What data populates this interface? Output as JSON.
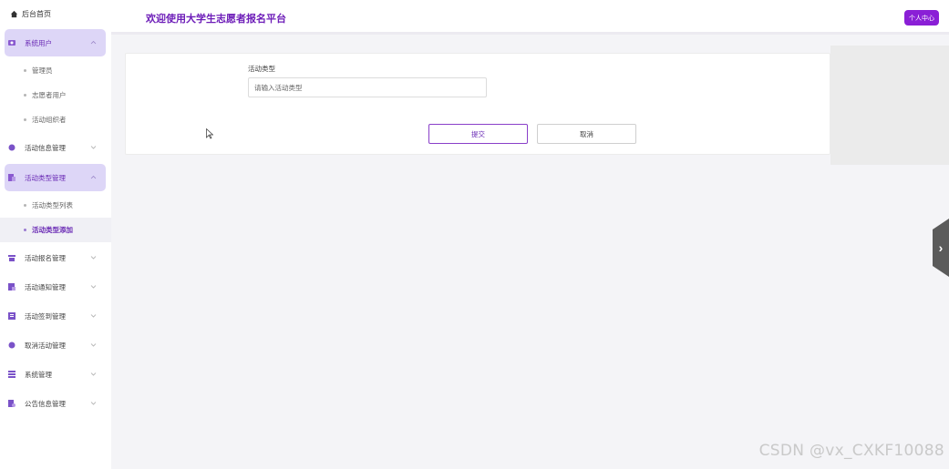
{
  "header": {
    "title": "欢迎使用大学生志愿者报名平台",
    "user_center": "个人中心"
  },
  "sidebar": {
    "home": "后台首页",
    "menus": [
      {
        "label": "系统用户",
        "icon": "user-icon",
        "expanded": true,
        "active": true,
        "children": [
          "管理员",
          "志愿者用户",
          "活动组织者"
        ]
      },
      {
        "label": "活动信息管理",
        "icon": "info-icon",
        "expanded": false
      },
      {
        "label": "活动类型管理",
        "icon": "category-icon",
        "expanded": true,
        "active": true,
        "children": [
          "活动类型列表",
          "活动类型添加"
        ]
      },
      {
        "label": "活动报名管理",
        "icon": "signup-icon",
        "expanded": false
      },
      {
        "label": "活动通知管理",
        "icon": "notice-icon",
        "expanded": false
      },
      {
        "label": "活动签到管理",
        "icon": "checkin-icon",
        "expanded": false
      },
      {
        "label": "取消活动管理",
        "icon": "cancel-icon",
        "expanded": false
      },
      {
        "label": "系统管理",
        "icon": "system-icon",
        "expanded": false
      },
      {
        "label": "公告信息管理",
        "icon": "announce-icon",
        "expanded": false
      }
    ],
    "current_sub": "活动类型添加"
  },
  "form": {
    "field_label": "活动类型",
    "field_placeholder": "请输入活动类型",
    "submit_label": "提交",
    "cancel_label": "取消"
  },
  "watermark": "CSDN @vx_CXKF10088",
  "colors": {
    "accent": "#8a1fd6",
    "title": "#6d1db8",
    "active_menu_bg": "#ddd6f7"
  }
}
